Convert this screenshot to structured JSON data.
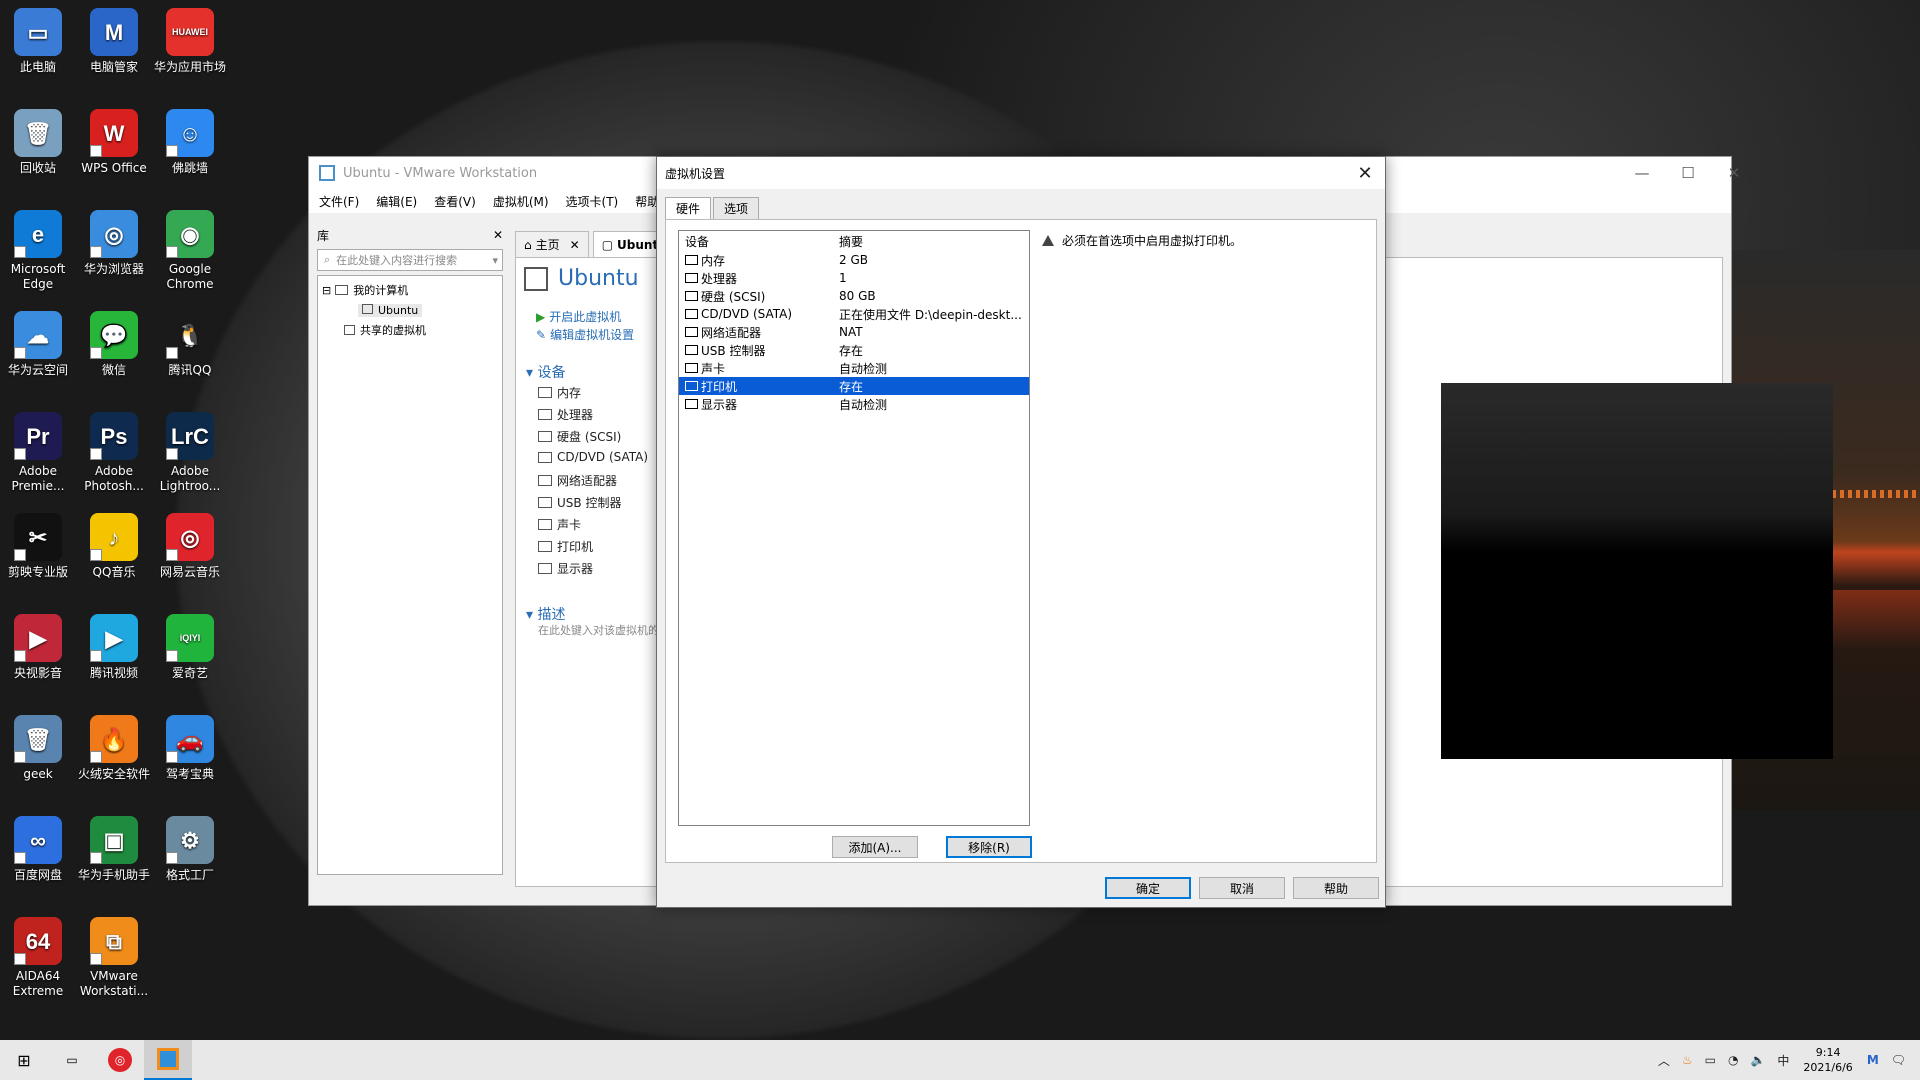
{
  "desktop_icons": [
    {
      "label": "此电脑",
      "color": "#3a7bd5",
      "glyph": "▭"
    },
    {
      "label": "电脑管家",
      "color": "#2a66c8",
      "glyph": "M"
    },
    {
      "label": "华为应用市场",
      "color": "#e4312b",
      "glyph": "HUAWEI"
    },
    {
      "label": "回收站",
      "color": "#7aa0c0",
      "glyph": "🗑"
    },
    {
      "label": "WPS Office",
      "color": "#d8201e",
      "glyph": "W"
    },
    {
      "label": "佛跳墙",
      "color": "#2d89ef",
      "glyph": "☺"
    },
    {
      "label": "Microsoft Edge",
      "color": "#0f7bd6",
      "glyph": "e"
    },
    {
      "label": "华为浏览器",
      "color": "#3a8dde",
      "glyph": "◎"
    },
    {
      "label": "Google Chrome",
      "color": "#34a853",
      "glyph": "◉"
    },
    {
      "label": "华为云空间",
      "color": "#3a8dde",
      "glyph": "☁"
    },
    {
      "label": "微信",
      "color": "#27b53a",
      "glyph": "💬"
    },
    {
      "label": "腾讯QQ",
      "color": "#1a1a1a",
      "glyph": "🐧"
    },
    {
      "label": "Adobe Premie...",
      "color": "#1e1a52",
      "glyph": "Pr"
    },
    {
      "label": "Adobe Photosh...",
      "color": "#0e2a4f",
      "glyph": "Ps"
    },
    {
      "label": "Adobe Lightroo...",
      "color": "#0d2a4a",
      "glyph": "LrC"
    },
    {
      "label": "剪映专业版",
      "color": "#111111",
      "glyph": "✂"
    },
    {
      "label": "QQ音乐",
      "color": "#f5c400",
      "glyph": "♪"
    },
    {
      "label": "网易云音乐",
      "color": "#e0242b",
      "glyph": "◎"
    },
    {
      "label": "央视影音",
      "color": "#c0283a",
      "glyph": "▶"
    },
    {
      "label": "腾讯视频",
      "color": "#1fa7e0",
      "glyph": "▶"
    },
    {
      "label": "爱奇艺",
      "color": "#21b43c",
      "glyph": "iQIYI"
    },
    {
      "label": "geek",
      "color": "#5a84b0",
      "glyph": "🗑"
    },
    {
      "label": "火绒安全软件",
      "color": "#f07a1a",
      "glyph": "🔥"
    },
    {
      "label": "驾考宝典",
      "color": "#2f87e0",
      "glyph": "🚗"
    },
    {
      "label": "百度网盘",
      "color": "#2e6fe0",
      "glyph": "∞"
    },
    {
      "label": "华为手机助手",
      "color": "#1f8b3e",
      "glyph": "▣"
    },
    {
      "label": "格式工厂",
      "color": "#6a8aa0",
      "glyph": "⚙"
    },
    {
      "label": "AIDA64 Extreme",
      "color": "#c0221e",
      "glyph": "64"
    },
    {
      "label": "VMware Workstati...",
      "color": "#f08c1a",
      "glyph": "⧉"
    }
  ],
  "vmware": {
    "title": "Ubuntu - VMware Workstation",
    "menu": [
      "文件(F)",
      "编辑(E)",
      "查看(V)",
      "虚拟机(M)",
      "选项卡(T)",
      "帮助(H)"
    ],
    "library_label": "库",
    "search_placeholder": "在此处键入内容进行搜索",
    "tree": {
      "my_computer": "我的计算机",
      "vm": "Ubuntu",
      "shared": "共享的虚拟机"
    },
    "tabs": [
      "主页",
      "Ubuntu"
    ],
    "vm_title": "Ubuntu",
    "actions": [
      "开启此虚拟机",
      "编辑虚拟机设置"
    ],
    "devices_header": "设备",
    "devices": [
      "内存",
      "处理器",
      "硬盘 (SCSI)",
      "CD/DVD (SATA)",
      "网络适配器",
      "USB 控制器",
      "声卡",
      "打印机",
      "显示器"
    ],
    "description_header": "描述",
    "description_placeholder": "在此处键入对该虚拟机的描述。"
  },
  "dialog": {
    "title": "虚拟机设置",
    "tabs": [
      "硬件",
      "选项"
    ],
    "columns": {
      "device": "设备",
      "summary": "摘要"
    },
    "rows": [
      {
        "device": "内存",
        "summary": "2 GB"
      },
      {
        "device": "处理器",
        "summary": "1"
      },
      {
        "device": "硬盘 (SCSI)",
        "summary": "80 GB"
      },
      {
        "device": "CD/DVD (SATA)",
        "summary": "正在使用文件 D:\\deepin-deskt..."
      },
      {
        "device": "网络适配器",
        "summary": "NAT"
      },
      {
        "device": "USB 控制器",
        "summary": "存在"
      },
      {
        "device": "声卡",
        "summary": "自动检测"
      },
      {
        "device": "打印机",
        "summary": "存在"
      },
      {
        "device": "显示器",
        "summary": "自动检测"
      }
    ],
    "selected_row": 7,
    "warning": "必须在首选项中启用虚拟打印机。",
    "add": "添加(A)...",
    "remove": "移除(R)",
    "ok": "确定",
    "cancel": "取消",
    "help": "帮助"
  },
  "taskbar": {
    "ime": "中",
    "time": "9:14",
    "date": "2021/6/6",
    "tray_icons": [
      "chevron-up",
      "huorong",
      "battery",
      "wifi",
      "volume"
    ]
  }
}
